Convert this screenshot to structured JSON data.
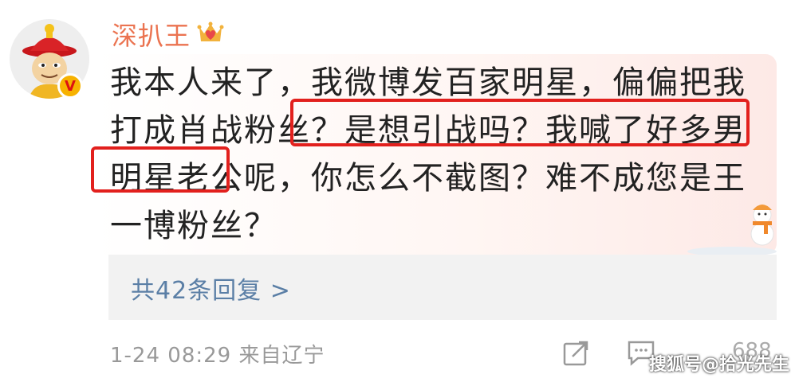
{
  "user": {
    "name": "深扒王",
    "badge_icon": "crown-heart-icon",
    "verified_icon": "v-badge-icon"
  },
  "comment": {
    "text": "我本人来了，我微博发百家明星，偏偏把我打成肖战粉丝？是想引战吗？我喊了好多男明星老公呢，你怎么不截图？难不成您是王一博粉丝？"
  },
  "replies": {
    "label": "共42条回复 >"
  },
  "meta": {
    "time_location": "1-24 08:29  来自辽宁",
    "like_count": "688"
  },
  "watermark": "搜狐号@拾光先生",
  "colors": {
    "username": "#eb7350",
    "link": "#5b7fa6",
    "highlight_border": "#e2201d"
  }
}
